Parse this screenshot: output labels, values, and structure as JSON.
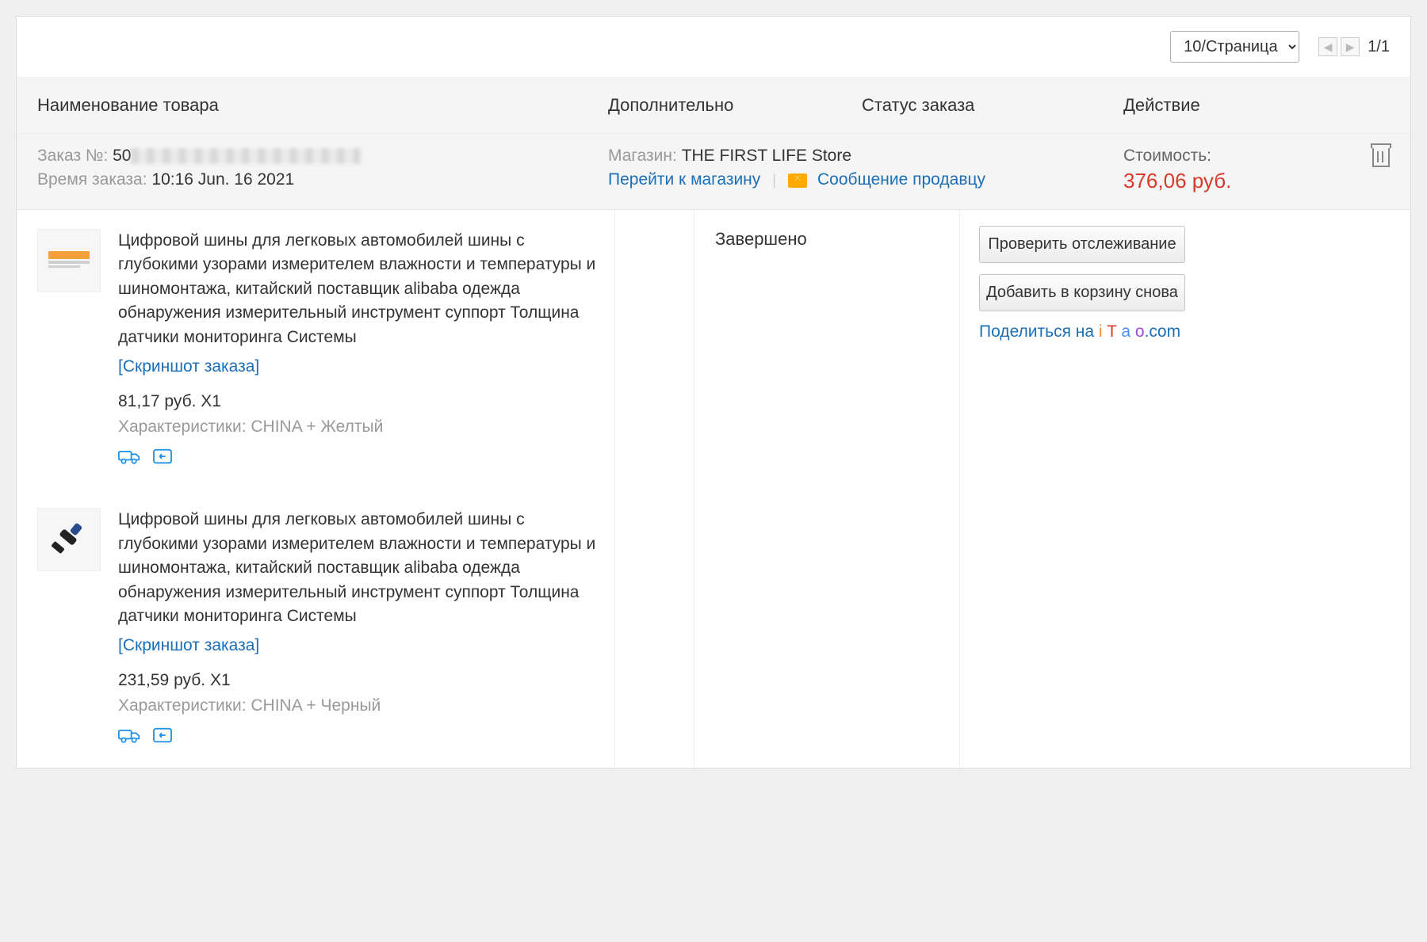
{
  "pagination": {
    "perPageLabel": "10/Страница",
    "pageText": "1/1"
  },
  "headers": {
    "name": "Наименование товара",
    "extra": "Дополнительно",
    "status": "Статус заказа",
    "action": "Действие"
  },
  "order": {
    "orderNoLabel": "Заказ №: ",
    "orderNoPrefix": "50",
    "timeLabel": "Время заказа: ",
    "timeValue": "10:16 Jun. 16 2021",
    "storeLabel": "Магазин: ",
    "storeName": "THE FIRST LIFE Store",
    "goToStore": "Перейти к магазину",
    "messageSeller": "Сообщение продавцу",
    "costLabel": "Стоимость:",
    "costValue": "376,06 руб."
  },
  "status": "Завершено",
  "actions": {
    "track": "Проверить отслеживание",
    "addAgain": "Добавить в корзину снова",
    "shareOn": "Поделиться на ",
    "shareBrand": {
      "i": "i",
      "t": "T",
      "a": "a",
      "o": "o",
      "dotcom": ".com"
    }
  },
  "products": [
    {
      "title": "Цифровой шины для легковых автомобилей шины с глубокими узорами измерителем влажности и температуры и шиномонтажа, китайский поставщик alibaba одежда обнаружения измерительный инструмент суппорт Толщина датчики мониторинга Системы",
      "snapshot": "[Скриншот заказа]",
      "price": "81,17 руб. X1",
      "chars": "Характеристики: CHINA + Желтый"
    },
    {
      "title": "Цифровой шины для легковых автомобилей шины с глубокими узорами измерителем влажности и температуры и шиномонтажа, китайский поставщик alibaba одежда обнаружения измерительный инструмент суппорт Толщина датчики мониторинга Системы",
      "snapshot": "[Скриншот заказа]",
      "price": "231,59 руб. X1",
      "chars": "Характеристики: CHINA + Черный"
    }
  ]
}
